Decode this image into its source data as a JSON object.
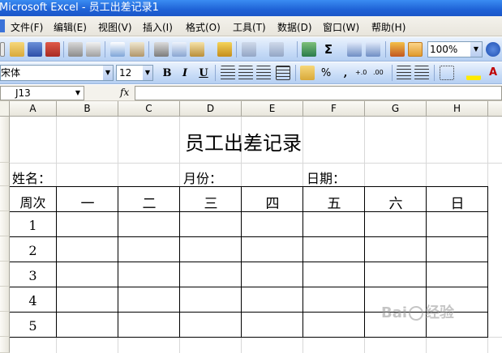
{
  "window": {
    "title": "Microsoft Excel - 员工出差记录1"
  },
  "menu": {
    "items": [
      "文件(F)",
      "编辑(E)",
      "视图(V)",
      "插入(I)",
      "格式(O)",
      "工具(T)",
      "数据(D)",
      "窗口(W)",
      "帮助(H)"
    ]
  },
  "toolbar": {
    "zoom": "100%"
  },
  "format_toolbar": {
    "font": "宋体",
    "size": "12",
    "bold": "B",
    "italic": "I",
    "underline": "U",
    "percent": "%",
    "comma": ","
  },
  "formula_bar": {
    "name_box": "J13",
    "fx": "fx",
    "formula": ""
  },
  "columns": [
    "A",
    "B",
    "C",
    "D",
    "E",
    "F",
    "G",
    "H"
  ],
  "sheet": {
    "title": "员工出差记录",
    "name_label": "姓名：",
    "month_label": "月份：",
    "date_label": "日期：",
    "week_header": "周次",
    "days": [
      "一",
      "二",
      "三",
      "四",
      "五",
      "六",
      "日"
    ],
    "weeks": [
      "1",
      "2",
      "3",
      "4",
      "5"
    ]
  },
  "watermark": {
    "text": "Bai",
    "suffix": "经验"
  },
  "colors": {
    "titlebar": "#1f62d6",
    "toolbar": "#c8dcf7",
    "menubar": "#ece9d8"
  }
}
